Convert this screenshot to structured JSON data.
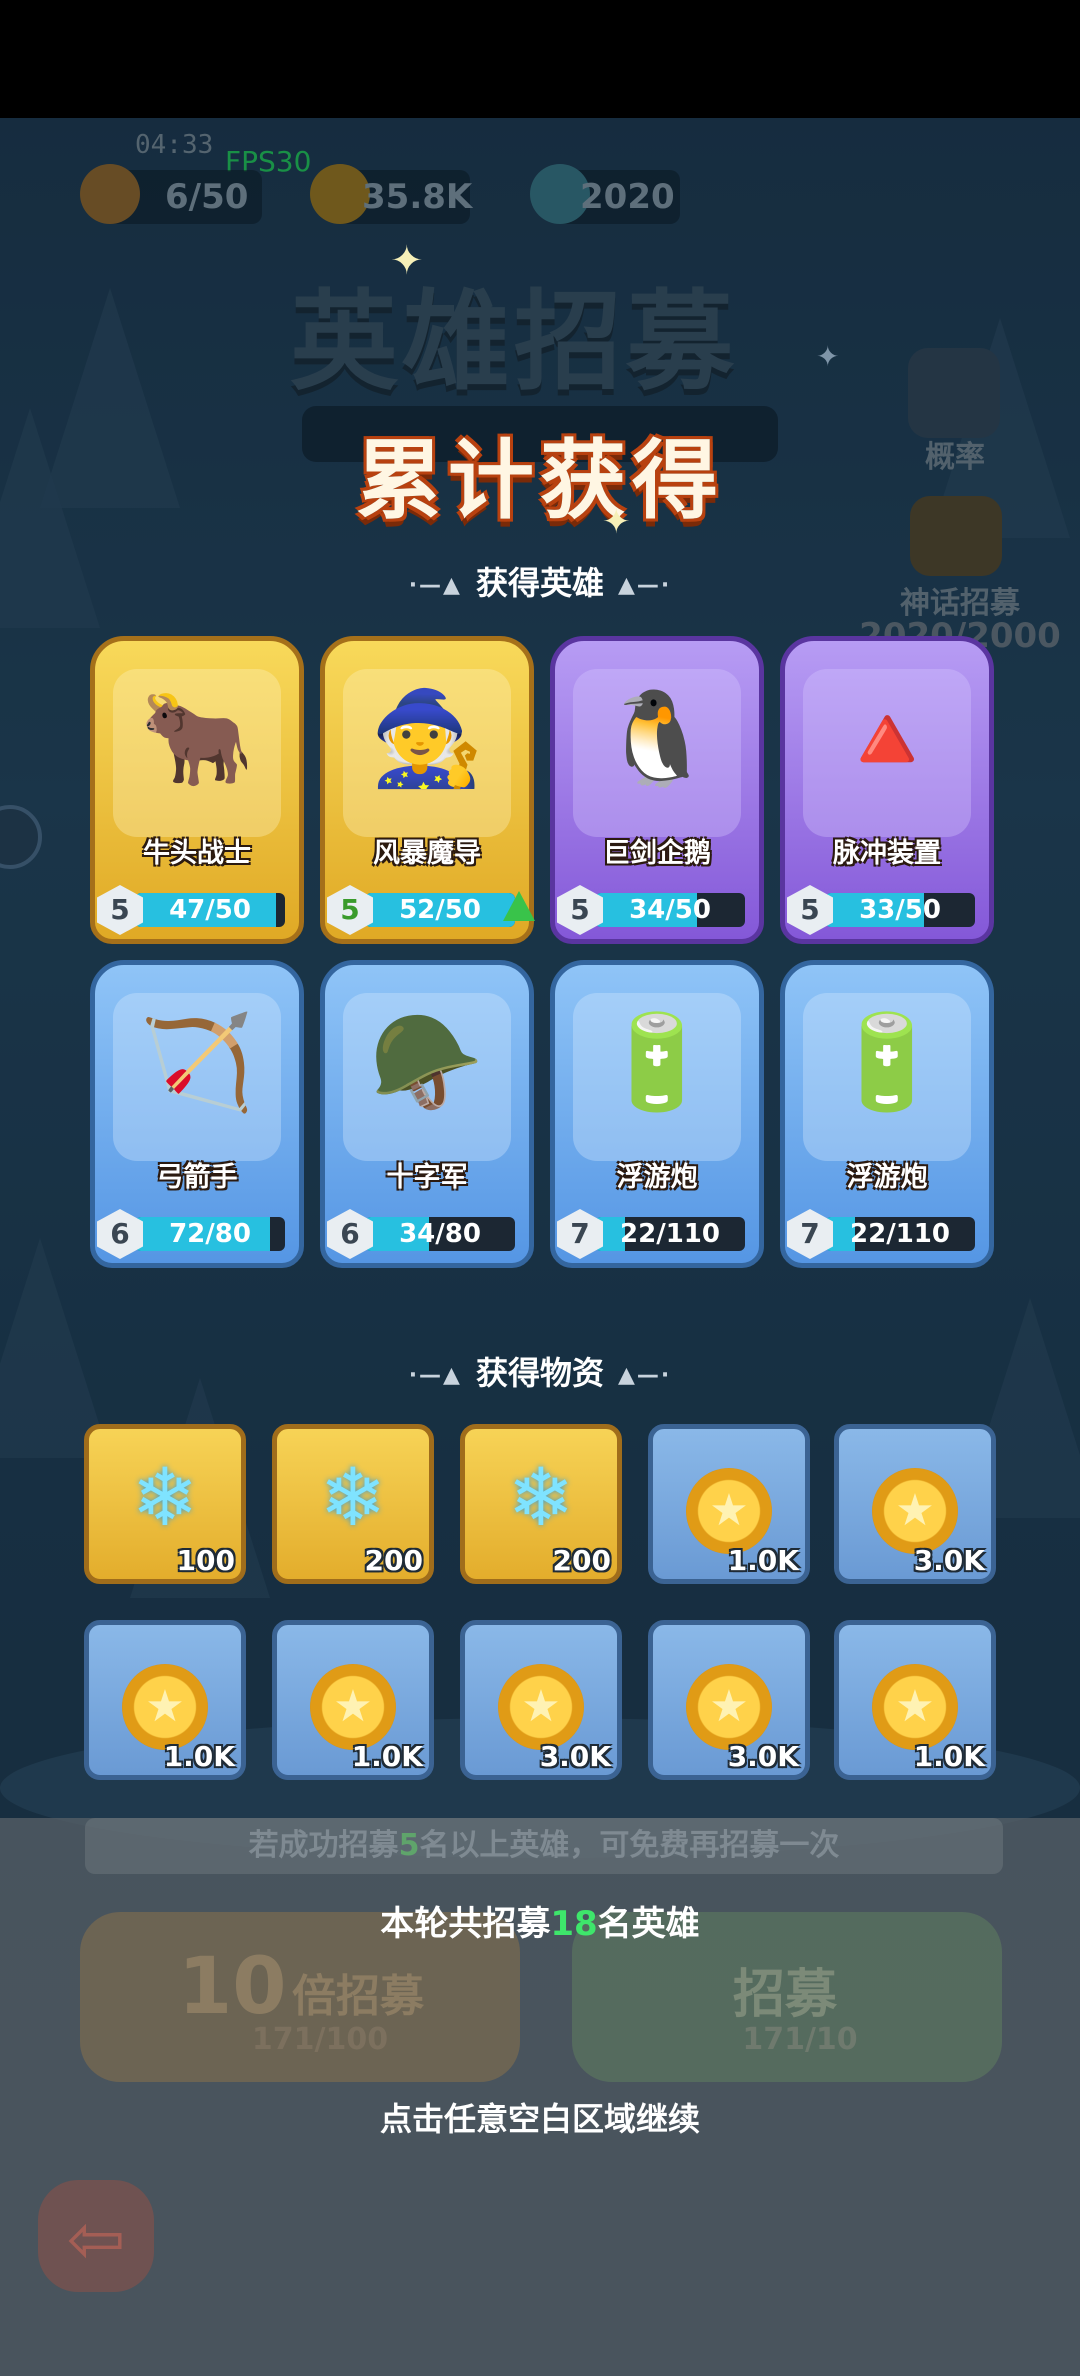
{
  "status": {
    "time": "04:33",
    "fps": "FPS30"
  },
  "resources": [
    {
      "icon": "flame-energy-icon",
      "value": "6/50"
    },
    {
      "icon": "gold-coin-icon",
      "value": "35.8K"
    },
    {
      "icon": "crystal-icon",
      "value": "2020"
    }
  ],
  "background": {
    "title": "英雄招募",
    "probability_label": "概率",
    "mythic_label": "神话招募",
    "mythic_progress": "2020/2000"
  },
  "headline": "累计获得",
  "heroes_section": {
    "title": "获得英雄"
  },
  "heroes": [
    {
      "name": "牛头战士",
      "level": "5",
      "progress": "47/50",
      "fill": 0.94,
      "rarity": "gold",
      "icon": "minotaur-warrior-icon",
      "glyph": "🐂"
    },
    {
      "name": "风暴魔导",
      "level": "5",
      "progress": "52/50",
      "fill": 1.0,
      "rarity": "gold",
      "icon": "storm-mage-icon",
      "glyph": "🧙",
      "upgrade": true
    },
    {
      "name": "巨剑企鹅",
      "level": "5",
      "progress": "34/50",
      "fill": 0.68,
      "rarity": "purple",
      "icon": "greatsword-penguin-icon",
      "glyph": "🐧"
    },
    {
      "name": "脉冲装置",
      "level": "5",
      "progress": "33/50",
      "fill": 0.66,
      "rarity": "purple",
      "icon": "pulse-device-icon",
      "glyph": "🔺"
    },
    {
      "name": "弓箭手",
      "level": "6",
      "progress": "72/80",
      "fill": 0.9,
      "rarity": "blue",
      "icon": "archer-icon",
      "glyph": "🏹"
    },
    {
      "name": "十字军",
      "level": "6",
      "progress": "34/80",
      "fill": 0.425,
      "rarity": "blue",
      "icon": "crusader-icon",
      "glyph": "🪖"
    },
    {
      "name": "浮游炮",
      "level": "7",
      "progress": "22/110",
      "fill": 0.2,
      "rarity": "blue",
      "icon": "floating-cannon-icon",
      "glyph": "🔋"
    },
    {
      "name": "浮游炮",
      "level": "7",
      "progress": "22/110",
      "fill": 0.2,
      "rarity": "blue",
      "icon": "floating-cannon-icon",
      "glyph": "🔋"
    }
  ],
  "items_section": {
    "title": "获得物资"
  },
  "items": [
    {
      "type": "crystal",
      "icon": "crystal-icon",
      "count": "100",
      "rarity": "gold"
    },
    {
      "type": "crystal",
      "icon": "crystal-icon",
      "count": "200",
      "rarity": "gold"
    },
    {
      "type": "crystal",
      "icon": "crystal-icon",
      "count": "200",
      "rarity": "gold"
    },
    {
      "type": "coin",
      "icon": "gold-coin-icon",
      "count": "1.0K",
      "rarity": "blue"
    },
    {
      "type": "coin",
      "icon": "gold-coin-icon",
      "count": "3.0K",
      "rarity": "blue"
    },
    {
      "type": "coin",
      "icon": "gold-coin-icon",
      "count": "1.0K",
      "rarity": "blue"
    },
    {
      "type": "coin",
      "icon": "gold-coin-icon",
      "count": "1.0K",
      "rarity": "blue"
    },
    {
      "type": "coin",
      "icon": "gold-coin-icon",
      "count": "3.0K",
      "rarity": "blue"
    },
    {
      "type": "coin",
      "icon": "gold-coin-icon",
      "count": "3.0K",
      "rarity": "blue"
    },
    {
      "type": "coin",
      "icon": "gold-coin-icon",
      "count": "1.0K",
      "rarity": "blue"
    }
  ],
  "bottom": {
    "hint_prefix": "若成功招募",
    "hint_num": "5",
    "hint_suffix": "名以上英雄，可免费再招募一次",
    "ten_recruit_num": "10",
    "ten_recruit_label": "倍招募",
    "ten_recruit_cost": "171/100",
    "recruit_label": "招募",
    "recruit_cost": "171/10",
    "result_prefix": "本轮共招募",
    "result_count": "18",
    "result_suffix": "名英雄",
    "continue_text": "点击任意空白区域继续"
  },
  "colors": {
    "gold_card": "#f0c640",
    "purple_card": "#9d78e6",
    "blue_card": "#6fa9ec",
    "headline_outline": "#b8410f",
    "highlight_green": "#3ee66b"
  }
}
